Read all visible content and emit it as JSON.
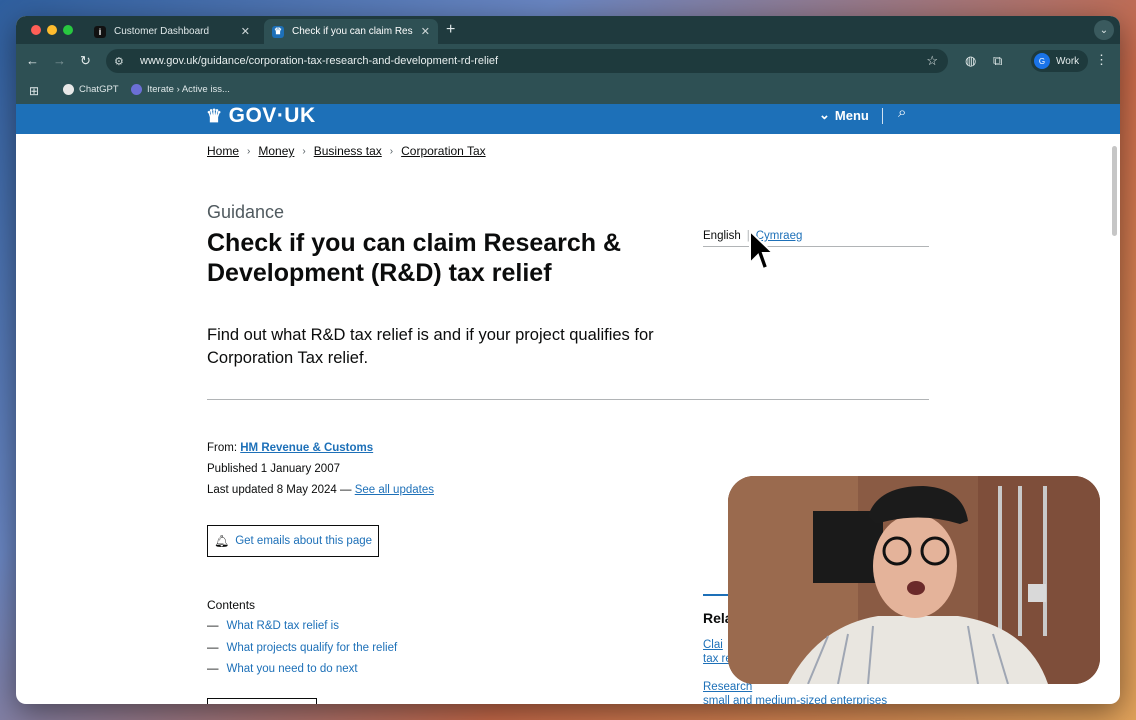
{
  "browser": {
    "tabs": [
      {
        "title": "Customer Dashboard",
        "active": false
      },
      {
        "title": "Check if you can claim Researc",
        "active": true
      }
    ],
    "url": "www.gov.uk/guidance/corporation-tax-research-and-development-rd-relief",
    "profile_label": "Work",
    "profile_initial": "G",
    "bookmarks": [
      {
        "label": "ChatGPT"
      },
      {
        "label": "Iterate › Active iss..."
      }
    ]
  },
  "govuk": {
    "logo": "GOV·UK",
    "menu_label": "Menu"
  },
  "page": {
    "breadcrumbs": [
      "Home",
      "Money",
      "Business tax",
      "Corporation Tax"
    ],
    "caption": "Guidance",
    "title": "Check if you can claim Research & Development (R&D) tax relief",
    "lang_current": "English",
    "lang_other": "Cymraeg",
    "lead": "Find out what R&D tax relief is and if your project qualifies for Corporation Tax relief.",
    "from_label": "From:",
    "from_org": "HM Revenue & Customs",
    "published": "Published 1 January 2007",
    "updated_prefix": "Last updated 8 May 2024 —",
    "see_updates": "See all updates",
    "email_button": "Get emails about this page",
    "contents_heading": "Contents",
    "contents": [
      "What R&D tax relief is",
      "What projects qualify for the relief",
      "What you need to do next"
    ],
    "related_heading": "Rela",
    "related_links": [
      "Clai",
      "tax re",
      "Research",
      "small and medium-sized enterprises"
    ]
  },
  "colors": {
    "govuk_blue": "#1d70b8",
    "chrome_dark": "#1f3a3e",
    "chrome_toolbar": "#2e5054"
  }
}
